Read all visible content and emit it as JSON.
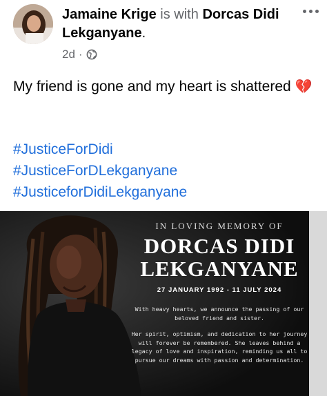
{
  "post": {
    "author": "Jamaine Krige",
    "with_text": "is with",
    "tagged": "Dorcas Didi Lekganyane",
    "period": ".",
    "time": "2d",
    "separator": "·",
    "privacy_icon": "globe-icon",
    "more_icon": "more-options-icon",
    "message": "My friend is gone and my heart is shattered",
    "emoji": "💔",
    "hashtags": [
      "#JusticeForDidi",
      "#JusticeForDLekganyane",
      "#JusticeforDidiLekganyane"
    ]
  },
  "image": {
    "kicker": "IN LOVING MEMORY OF",
    "name_line1": "DORCAS DIDI",
    "name_line2": "LEKGANYANE",
    "dates": "27 JANUARY 1992 - 11 JULY 2024",
    "paragraph1": "With heavy hearts, we announce the passing of our beloved friend and sister.",
    "paragraph2": "Her spirit, optimism, and dedication to her journey will forever be remembered. She leaves behind a legacy of love and inspiration, reminding us all to pursue our dreams with passion and determination."
  },
  "colors": {
    "link": "#216fdb",
    "muted": "#65676b",
    "photo_bg": "#0e0e0e"
  }
}
